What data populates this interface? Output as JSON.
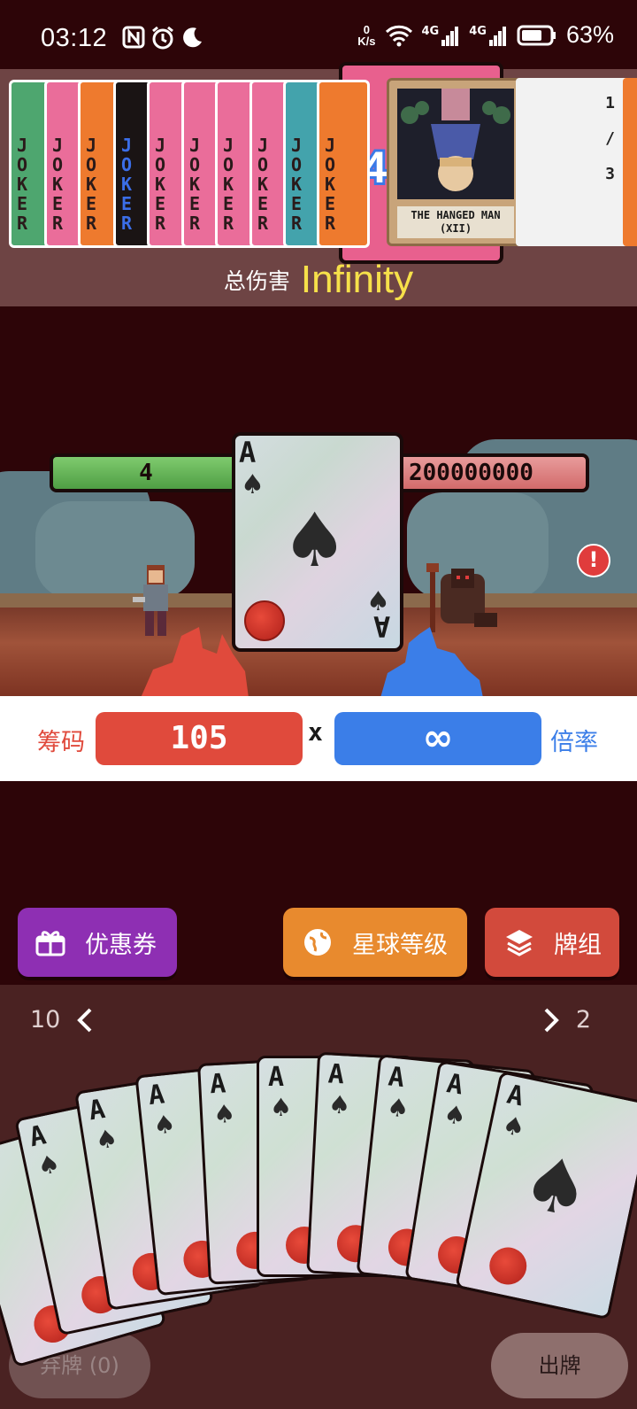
{
  "status": {
    "time": "03:12",
    "net_speed_value": "0",
    "net_speed_unit": "K/s",
    "net1": "4G",
    "net2": "4G",
    "battery": "63%"
  },
  "jokers": {
    "label": "JOKER",
    "tarot_name": "THE HANGED MAN (XII)",
    "multiplier_badge": "X4",
    "info": [
      "1",
      "/",
      "3"
    ],
    "colors": [
      "#4ea66f",
      "#ea6d9a",
      "#ee7a2e",
      "#1a1414",
      "#ea6d9a",
      "#ea6d9a",
      "#ea6d9a",
      "#ea6d9a",
      "#43a3ac",
      "#ee7a2e"
    ]
  },
  "damage": {
    "label": "总伤害",
    "value": "Infinity"
  },
  "battle": {
    "player_hp": "4",
    "enemy_hp": "200000000",
    "card_rank": "A",
    "card_suit": "♠",
    "alert": "!"
  },
  "score": {
    "chips_label": "筹码",
    "chips_value": "105",
    "times": "x",
    "mult_value": "∞",
    "mult_label": "倍率"
  },
  "buttons": {
    "coupon": "优惠券",
    "planet": "星球等级",
    "deck": "牌组"
  },
  "hand": {
    "left_count": "10",
    "right_count": "2",
    "card_rank": "A",
    "card_suit": "♠",
    "discard": "弃牌 (0)",
    "play": "出牌"
  }
}
